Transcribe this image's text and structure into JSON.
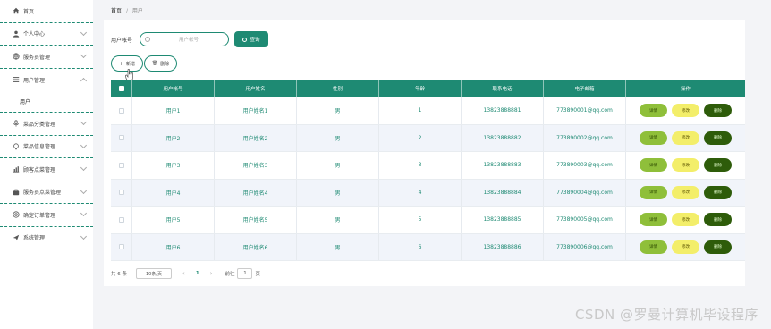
{
  "sidebar": {
    "items": [
      {
        "label": "首页",
        "icon": "home-icon",
        "chevron": false
      },
      {
        "label": "个人中心",
        "icon": "user-icon",
        "chevron": true
      },
      {
        "label": "服务员管理",
        "icon": "globe-icon",
        "chevron": true
      },
      {
        "label": "用户管理",
        "icon": "list-icon",
        "chevron": true,
        "expanded": true,
        "sub": [
          "用户"
        ]
      },
      {
        "label": "菜品分类管理",
        "icon": "mic-icon",
        "chevron": true
      },
      {
        "label": "菜品信息管理",
        "icon": "bulb-icon",
        "chevron": true
      },
      {
        "label": "顾客点菜管理",
        "icon": "chart-icon",
        "chevron": true
      },
      {
        "label": "服务员点菜管理",
        "icon": "briefcase-icon",
        "chevron": true
      },
      {
        "label": "确定订单管理",
        "icon": "circle-icon",
        "chevron": true
      },
      {
        "label": "系统管理",
        "icon": "send-icon",
        "chevron": true
      }
    ]
  },
  "breadcrumb": {
    "home": "首页",
    "sep": "/",
    "current": "用户"
  },
  "search": {
    "label": "用户帐号",
    "placeholder": "用户帐号",
    "value": "",
    "button": "查询"
  },
  "actions": {
    "add": "新增",
    "delete": "删除"
  },
  "table": {
    "headers": [
      "用户帐号",
      "用户姓名",
      "性别",
      "年龄",
      "联系电话",
      "电子邮箱",
      "操作"
    ],
    "rows": [
      [
        "用户1",
        "用户姓名1",
        "男",
        "1",
        "13823888881",
        "773890001@qq.com"
      ],
      [
        "用户2",
        "用户姓名2",
        "男",
        "2",
        "13823888882",
        "773890002@qq.com"
      ],
      [
        "用户3",
        "用户姓名3",
        "男",
        "3",
        "13823888883",
        "773890003@qq.com"
      ],
      [
        "用户4",
        "用户姓名4",
        "男",
        "4",
        "13823888884",
        "773890004@qq.com"
      ],
      [
        "用户5",
        "用户姓名5",
        "男",
        "5",
        "13823888885",
        "773890005@qq.com"
      ],
      [
        "用户6",
        "用户姓名6",
        "男",
        "6",
        "13823888886",
        "773890006@qq.com"
      ]
    ],
    "ops": {
      "detail": "详情",
      "edit": "修改",
      "delete": "删除"
    }
  },
  "pager": {
    "total": "共 6 条",
    "size": "10条/页",
    "prev": "‹",
    "page": "1",
    "next": "›",
    "goto": "前往",
    "jump": "1",
    "unit": "页"
  },
  "watermark": "CSDN @罗曼计算机毕设程序",
  "colors": {
    "primary": "#1e8a73",
    "detail": "#8fbf3a",
    "edit": "#f3ee6a",
    "delete": "#2e5c0a"
  }
}
